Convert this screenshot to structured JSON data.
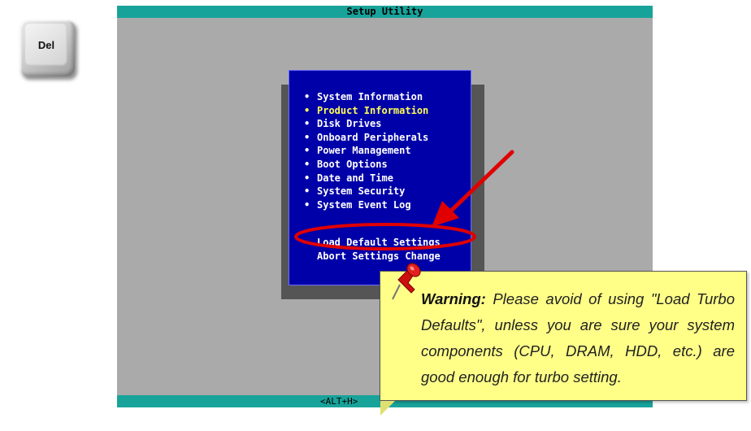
{
  "del_key": {
    "label": "Del"
  },
  "bios": {
    "title": "Setup Utility",
    "bottom_hint": "<ALT+H>",
    "menu_items": [
      {
        "label": "System Information",
        "selected": false
      },
      {
        "label": "Product Information",
        "selected": true
      },
      {
        "label": "Disk Drives",
        "selected": false
      },
      {
        "label": "Onboard Peripherals",
        "selected": false
      },
      {
        "label": "Power Management",
        "selected": false
      },
      {
        "label": "Boot Options",
        "selected": false
      },
      {
        "label": "Date and Time",
        "selected": false
      },
      {
        "label": "System Security",
        "selected": false
      },
      {
        "label": "System Event Log",
        "selected": false
      }
    ],
    "extra_items": [
      {
        "label": "Load Default Settings"
      },
      {
        "label": "Abort Settings Change"
      }
    ],
    "bullet": "•"
  },
  "note": {
    "title": "Warning:",
    "text": "Please avoid of using \"Load Turbo Defaults\", unless you are sure your system components (CPU, DRAM, HDD, etc.) are good enough for turbo setting."
  },
  "colors": {
    "menu_bg": "#0000a8",
    "bar": "#18a39a",
    "screen_bg": "#aaaaaa",
    "highlight": "#ffff55",
    "annotation": "#e00000",
    "note_bg": "#ffff88"
  },
  "icons": {
    "pin": "pushpin-icon",
    "arrow": "red-arrow-icon"
  }
}
